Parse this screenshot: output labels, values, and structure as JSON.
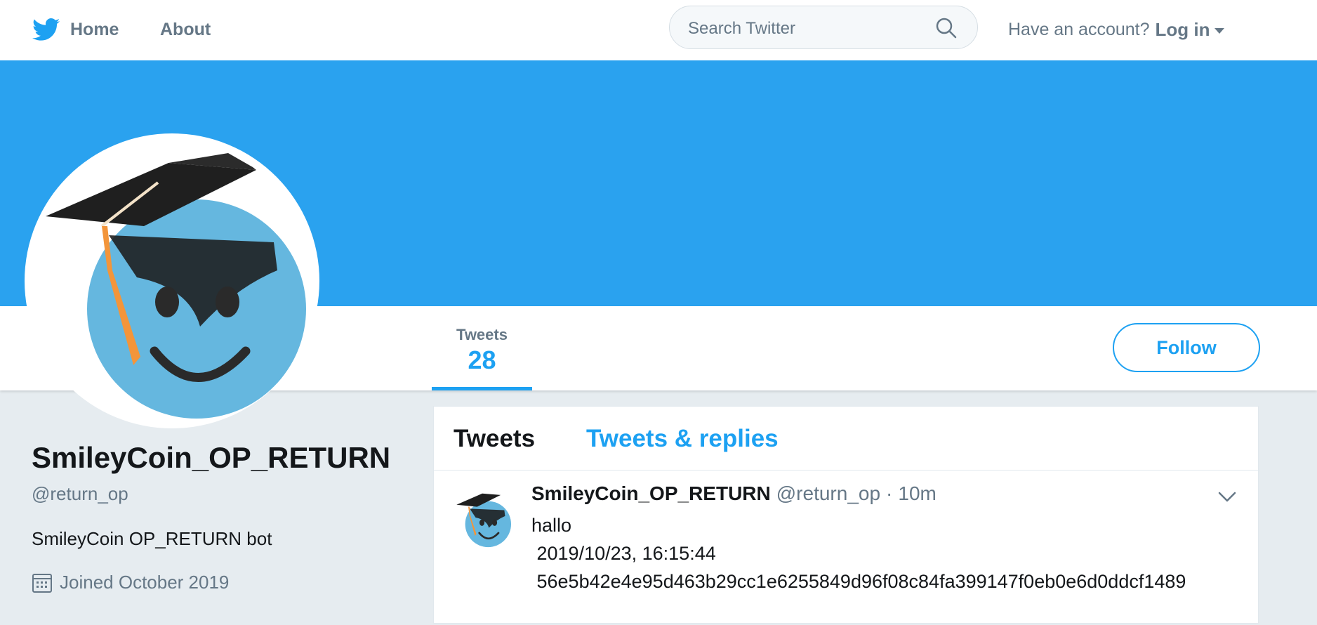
{
  "nav": {
    "home_label": "Home",
    "about_label": "About",
    "search_placeholder": "Search Twitter",
    "have_account_text": "Have an account?",
    "login_label": "Log in"
  },
  "profile": {
    "name": "SmileyCoin_OP_RETURN",
    "handle": "@return_op",
    "bio": "SmileyCoin OP_RETURN bot",
    "joined": "Joined October 2019"
  },
  "stats": {
    "tweets_label": "Tweets",
    "tweets_count": "28"
  },
  "follow_label": "Follow",
  "timeline": {
    "tabs": [
      {
        "label": "Tweets",
        "active": true
      },
      {
        "label": "Tweets & replies",
        "active": false
      }
    ],
    "tweets": [
      {
        "author_name": "SmileyCoin_OP_RETURN",
        "author_handle": "@return_op",
        "separator": "·",
        "time": "10m",
        "text": "hallo\n 2019/10/23, 16:15:44\n 56e5b42e4e95d463b29cc1e6255849d96f08c84fa399147f0eb0e6d0ddcf1489"
      }
    ]
  },
  "colors": {
    "brand_blue": "#1da1f2",
    "banner_blue": "#2aa2ef",
    "muted_gray": "#657786",
    "page_background": "#e6ecf0"
  },
  "icons": {
    "logo": "twitter-bird-icon",
    "search": "search-icon",
    "caret": "caret-down-icon",
    "calendar": "calendar-icon",
    "tweet_menu": "chevron-down-icon"
  }
}
